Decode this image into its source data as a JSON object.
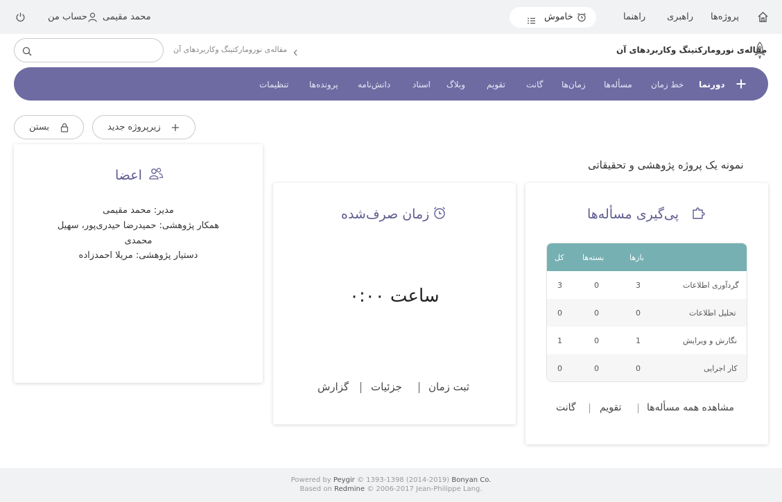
{
  "topbar": {
    "nav": [
      "پروژه‌ها",
      "راهبری",
      "راهنما"
    ],
    "timer_label": "خاموش",
    "user_name": "محمد مقیمی",
    "my_account": "حساب من"
  },
  "header": {
    "project_title": "مقاله‌ی نورومارکتینگ وکاربردهای آن",
    "breadcrumb": "مقاله‌ی نورومارکتینگ وکاربردهای آن",
    "search": {
      "value": "",
      "placeholder": ""
    }
  },
  "navbar": {
    "tabs": [
      "دورنما",
      "خط زمان",
      "مسأله‌ها",
      "زمان‌ها",
      "گانت",
      "تقویم",
      "وبلاگ",
      "اسناد",
      "دانش‌نامه",
      "پرونده‌ها",
      "تنظیمات"
    ],
    "active_index": 0
  },
  "actions": {
    "new_subproject": "زیرپروژه جدید",
    "close": "بستن"
  },
  "project_description": "نمونه یک پروژه پژوهشی و تحقیقاتی",
  "issues_card": {
    "title": "پی‌گیری مسأله‌ها",
    "columns": [
      "بازها",
      "بسته‌ها",
      "کل"
    ],
    "rows": [
      {
        "name": "گردآوری اطلاعات",
        "open": "3",
        "closed": "0",
        "total": "3"
      },
      {
        "name": "تحلیل اطلاعات",
        "open": "0",
        "closed": "0",
        "total": "0"
      },
      {
        "name": "نگارش و ویرایش",
        "open": "1",
        "closed": "0",
        "total": "1"
      },
      {
        "name": "کار اجرایی",
        "open": "0",
        "closed": "0",
        "total": "0"
      }
    ],
    "links": [
      "مشاهده همه مسأله‌ها",
      "تقویم",
      "گانت"
    ]
  },
  "time_card": {
    "title": "زمان صرف‌شده",
    "value": "۰:۰۰ ساعت",
    "links": [
      "ثبت زمان",
      "جزئیات",
      "گزارش"
    ]
  },
  "members_card": {
    "title": "اعضا",
    "lines": [
      {
        "role": "مدیر:",
        "names": "محمد مقیمی"
      },
      {
        "role": "همکار پژوهشی:",
        "names": "حمیدرضا حیدری‌پور، سهیل"
      },
      {
        "role": "",
        "names": "محمدی"
      },
      {
        "role": "دستیار پژوهشی:",
        "names": "مریلا احمدزاده"
      }
    ]
  },
  "footer": {
    "powered_by": "Powered by",
    "peygir": "Peygir",
    "line1_rest": "© 1393-1398 (2014-2019)",
    "company": "Bonyan Co.",
    "based_on": "Based on",
    "redmine": "Redmine",
    "line2_rest": "© 2006-2017 Jean-Philippe Lang."
  },
  "colors": {
    "navbar": "#6e6ba3",
    "active_tab_marker": "#e8716e",
    "table_header": "#76b0b3",
    "card_title": "#5e5b8f"
  }
}
